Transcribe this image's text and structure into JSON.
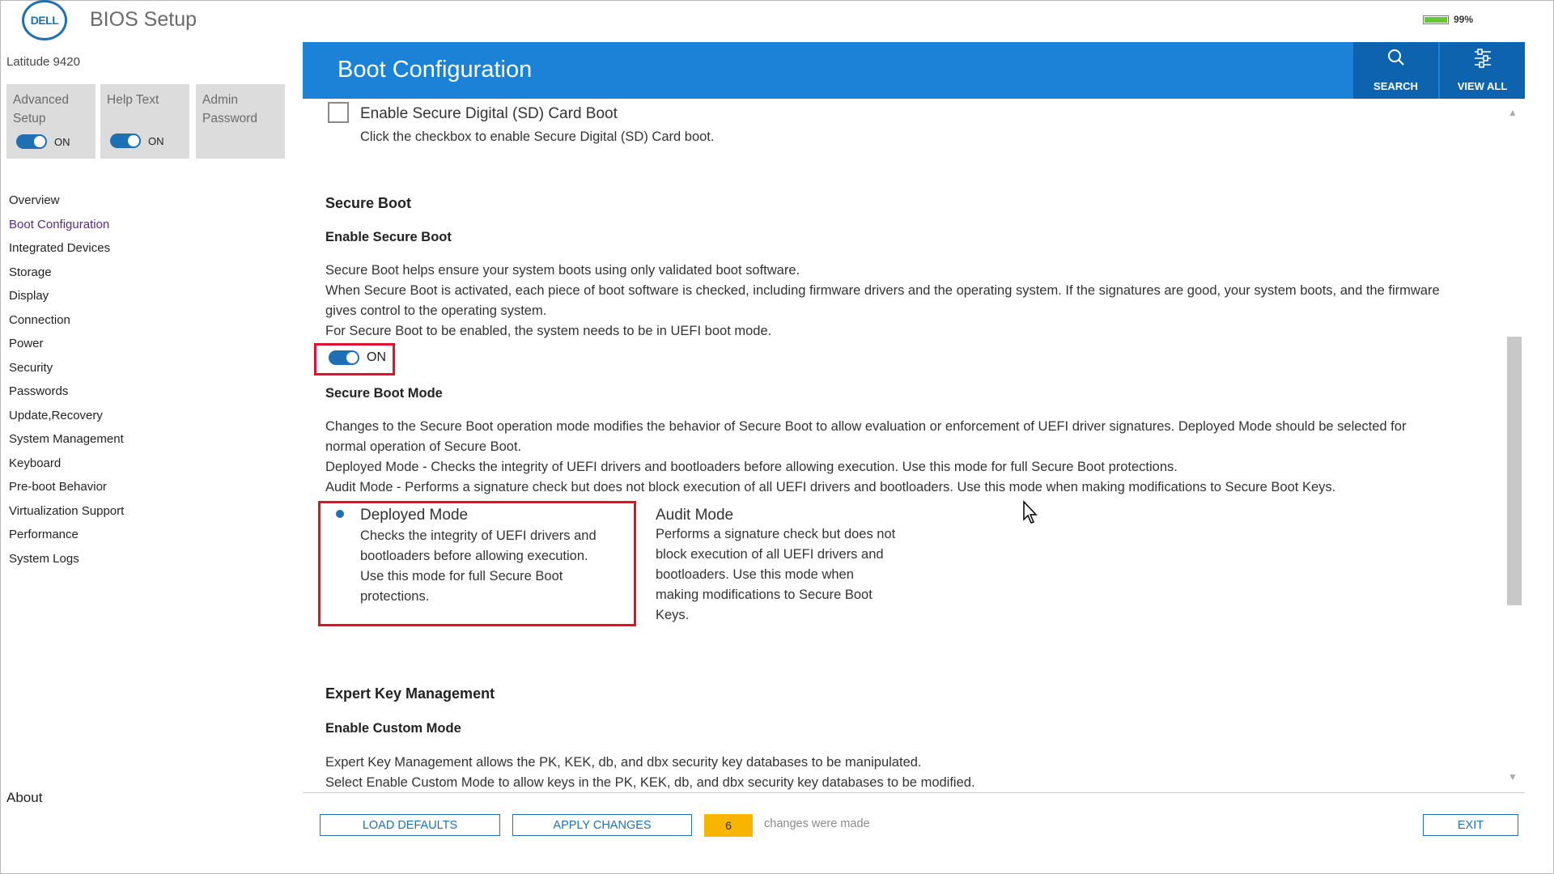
{
  "header": {
    "logo_text": "DELL",
    "app_title": "BIOS Setup",
    "battery_percent": "99%",
    "battery_level": 0.99
  },
  "sidebar": {
    "model": "Latitude 9420",
    "tiles": [
      {
        "label_line1": "Advanced",
        "label_line2": "Setup",
        "toggle_state": "ON"
      },
      {
        "label_line1": "Help Text",
        "label_line2": "",
        "toggle_state": "ON"
      },
      {
        "label_line1": "Admin",
        "label_line2": "Password"
      }
    ],
    "nav_items": [
      "Overview",
      "Boot Configuration",
      "Integrated Devices",
      "Storage",
      "Display",
      "Connection",
      "Power",
      "Security",
      "Passwords",
      "Update,Recovery",
      "System Management",
      "Keyboard",
      "Pre-boot Behavior",
      "Virtualization Support",
      "Performance",
      "System Logs"
    ],
    "active_item": "Boot Configuration",
    "about": "About"
  },
  "topbar": {
    "title": "Boot Configuration",
    "search_label": "SEARCH",
    "view_all_label": "VIEW ALL"
  },
  "content": {
    "sd_card": {
      "title": "Enable Secure Digital (SD) Card Boot",
      "desc": "Click the checkbox to enable Secure Digital (SD) Card boot."
    },
    "secure_boot": {
      "heading": "Secure Boot",
      "subheading": "Enable Secure Boot",
      "lines": [
        "Secure Boot helps ensure your system boots using only validated boot software.",
        "When Secure Boot is activated, each piece of boot software is checked, including firmware drivers and the operating system. If the signatures are good, your system boots, and the firmware",
        "gives control to the operating system.",
        "For Secure Boot to be enabled, the system needs to be in UEFI boot mode."
      ],
      "toggle_state": "ON"
    },
    "secure_boot_mode": {
      "subheading": "Secure Boot Mode",
      "lines": [
        "Changes to the Secure Boot operation mode modifies the behavior of Secure Boot to allow evaluation or enforcement of UEFI driver signatures. Deployed Mode should be selected for",
        "normal operation of Secure Boot.",
        "Deployed Mode - Checks the integrity of UEFI drivers and bootloaders before allowing execution. Use this mode for full Secure Boot protections.",
        "Audit Mode - Performs a signature check but does not block execution of all UEFI drivers and bootloaders.  Use this mode when making modifications to Secure Boot Keys."
      ],
      "options": [
        {
          "title": "Deployed Mode",
          "lines": [
            "Checks the integrity of UEFI drivers and",
            "bootloaders before allowing execution.",
            "Use this mode for full Secure Boot",
            "protections."
          ]
        },
        {
          "title": "Audit Mode",
          "lines": [
            "Performs a signature check but does not",
            "block execution of all UEFI drivers and",
            "bootloaders.  Use this mode when",
            "making modifications to Secure Boot",
            "Keys."
          ]
        }
      ],
      "selected": "Deployed Mode"
    },
    "expert_key": {
      "heading": "Expert Key Management",
      "subheading": "Enable Custom Mode",
      "lines": [
        "Expert Key Management allows the PK, KEK, db, and dbx security key databases to be manipulated.",
        "Select Enable Custom Mode to allow keys in the PK, KEK, db, and dbx security key databases to be modified."
      ]
    }
  },
  "footer": {
    "load_defaults": "LOAD DEFAULTS",
    "apply_changes": "APPLY CHANGES",
    "change_count": "6",
    "changes_text": "changes were made",
    "exit": "EXIT"
  },
  "colors": {
    "accent_blue": "#1a83d8",
    "dark_blue": "#0d64ae",
    "highlight_red": "#e0102f",
    "count_badge": "#f7b500"
  }
}
